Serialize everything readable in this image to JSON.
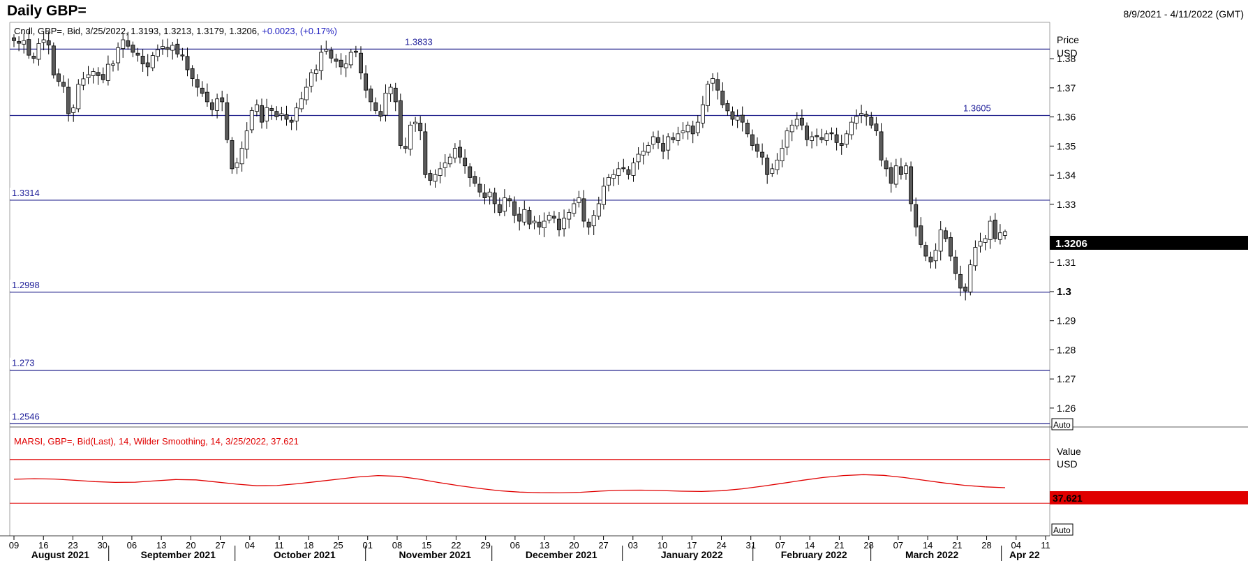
{
  "header": {
    "title": "Daily GBP=",
    "date_range": "8/9/2021 - 4/11/2022 (GMT)"
  },
  "price_panel": {
    "legend": "Cndl, GBP=, Bid, 3/25/2022, 1.3193, 1.3213, 1.3179, 1.3206,",
    "change": "+0.0023, (+0.17%)",
    "axis_title_1": "Price",
    "axis_title_2": "USD",
    "last_price": "1.3206",
    "auto_label": "Auto",
    "yticks": [
      {
        "v": 1.38,
        "label": "1.38"
      },
      {
        "v": 1.37,
        "label": "1.37"
      },
      {
        "v": 1.36,
        "label": "1.36"
      },
      {
        "v": 1.35,
        "label": "1.35"
      },
      {
        "v": 1.34,
        "label": "1.34"
      },
      {
        "v": 1.33,
        "label": "1.33"
      },
      {
        "v": 1.31,
        "label": "1.31"
      },
      {
        "v": 1.3,
        "label": "1.3",
        "bold": true
      },
      {
        "v": 1.29,
        "label": "1.29"
      },
      {
        "v": 1.28,
        "label": "1.28"
      },
      {
        "v": 1.27,
        "label": "1.27"
      },
      {
        "v": 1.26,
        "label": "1.26"
      }
    ]
  },
  "rsi_panel": {
    "legend": "MARSI, GBP=, Bid(Last),  14, Wilder Smoothing, 14, 3/25/2022, 37.621",
    "axis_title_1": "Value",
    "axis_title_2": "USD",
    "last_value": "37.621",
    "auto_label": "Auto"
  },
  "time_axis": {
    "day_ticks": [
      "09",
      "16",
      "23",
      "30",
      "06",
      "13",
      "20",
      "27",
      "04",
      "11",
      "18",
      "25",
      "01",
      "08",
      "15",
      "22",
      "29",
      "06",
      "13",
      "20",
      "27",
      "03",
      "10",
      "17",
      "24",
      "31",
      "07",
      "14",
      "21",
      "28",
      "07",
      "14",
      "21",
      "28",
      "04",
      "11"
    ],
    "months": [
      {
        "label": "August 2021",
        "day": 11
      },
      {
        "label": "September 2021",
        "day": 39
      },
      {
        "label": "October 2021",
        "day": 69
      },
      {
        "label": "November 2021",
        "day": 100
      },
      {
        "label": "December 2021",
        "day": 130
      },
      {
        "label": "January 2022",
        "day": 161
      },
      {
        "label": "February 2022",
        "day": 190
      },
      {
        "label": "March 2022",
        "day": 218
      },
      {
        "label": "Apr 22",
        "day": 240
      }
    ]
  },
  "colors": {
    "level_line": "#20208c",
    "level_text": "#20209a",
    "bear_candle": "#5a5a5a",
    "bull_candle": "#ffffff",
    "rsi_line": "#e00000",
    "rsi_badge": "#e00000",
    "price_badge": "#000000"
  },
  "chart_data": [
    {
      "type": "candlestick",
      "title": "Daily GBP=",
      "x_range": [
        "2021-08-09",
        "2022-04-11"
      ],
      "ylabel": "Price USD",
      "ylim": [
        1.2535,
        1.3925
      ],
      "horizontal_levels": [
        {
          "value": 1.3833,
          "label": "1.3833",
          "label_pos": "middle"
        },
        {
          "value": 1.3605,
          "label": "1.3605",
          "label_pos": "right"
        },
        {
          "value": 1.3314,
          "label": "1.3314",
          "label_pos": "left"
        },
        {
          "value": 1.2998,
          "label": "1.2998",
          "label_pos": "left"
        },
        {
          "value": 1.273,
          "label": "1.273",
          "label_pos": "left"
        },
        {
          "value": 1.2546,
          "label": "1.2546",
          "label_pos": "left"
        }
      ],
      "last": {
        "date": "2022-03-25",
        "open": 1.3193,
        "high": 1.3213,
        "low": 1.3179,
        "close": 1.3206
      },
      "closes": [
        1.3862,
        1.3853,
        1.3862,
        1.3812,
        1.3801,
        1.3852,
        1.3865,
        1.3847,
        1.3744,
        1.3722,
        1.3705,
        1.3611,
        1.3631,
        1.3712,
        1.3731,
        1.3745,
        1.3756,
        1.3742,
        1.3728,
        1.3781,
        1.3782,
        1.3838,
        1.3865,
        1.3843,
        1.3822,
        1.3812,
        1.3782,
        1.3772,
        1.3811,
        1.3831,
        1.3842,
        1.3832,
        1.3846,
        1.3816,
        1.3811,
        1.3762,
        1.3732,
        1.3702,
        1.3681,
        1.3652,
        1.3625,
        1.3662,
        1.3652,
        1.3522,
        1.3422,
        1.3442,
        1.3492,
        1.3552,
        1.3622,
        1.3642,
        1.3582,
        1.3632,
        1.3622,
        1.3601,
        1.3611,
        1.3592,
        1.3582,
        1.3631,
        1.3662,
        1.3702,
        1.3752,
        1.3762,
        1.3822,
        1.3832,
        1.3802,
        1.3791,
        1.3772,
        1.3782,
        1.3822,
        1.3822,
        1.3751,
        1.3692,
        1.3652,
        1.3622,
        1.3602,
        1.3682,
        1.3702,
        1.3652,
        1.3502,
        1.3492,
        1.3572,
        1.3582,
        1.3552,
        1.3402,
        1.3382,
        1.3402,
        1.3422,
        1.3442,
        1.3462,
        1.3492,
        1.3462,
        1.3432,
        1.3392,
        1.3372,
        1.3342,
        1.3322,
        1.3342,
        1.3302,
        1.3272,
        1.3322,
        1.3312,
        1.3262,
        1.3242,
        1.3282,
        1.3232,
        1.3242,
        1.3222,
        1.3242,
        1.3262,
        1.3252,
        1.3212,
        1.3252,
        1.3272,
        1.3302,
        1.3322,
        1.3242,
        1.3222,
        1.3262,
        1.3302,
        1.3362,
        1.3392,
        1.3402,
        1.3422,
        1.3422,
        1.3402,
        1.3442,
        1.3472,
        1.3482,
        1.3502,
        1.3532,
        1.3512,
        1.3482,
        1.3532,
        1.3522,
        1.3542,
        1.3552,
        1.3572,
        1.3542,
        1.3582,
        1.3642,
        1.3712,
        1.3732,
        1.3692,
        1.3642,
        1.3621,
        1.3592,
        1.3602,
        1.3582,
        1.3542,
        1.3502,
        1.3482,
        1.3462,
        1.3402,
        1.3422,
        1.3452,
        1.3492,
        1.3552,
        1.3572,
        1.3592,
        1.3572,
        1.3522,
        1.3532,
        1.3532,
        1.3522,
        1.3542,
        1.3542,
        1.3512,
        1.3502,
        1.3542,
        1.3582,
        1.3602,
        1.3612,
        1.3602,
        1.3572,
        1.3552,
        1.3452,
        1.3422,
        1.3372,
        1.3432,
        1.3402,
        1.3432,
        1.3302,
        1.3222,
        1.3162,
        1.3122,
        1.3102,
        1.3142,
        1.3212,
        1.3182,
        1.3122,
        1.3062,
        1.3012,
        1.3002,
        1.3092,
        1.3152,
        1.3172,
        1.3182,
        1.3242,
        1.3182,
        1.3202,
        1.3206
      ]
    },
    {
      "type": "line",
      "title": "MARSI, GBP=, Bid(Last), 14, Wilder Smoothing, 14",
      "ylabel": "Value USD",
      "last_value": 37.621,
      "upper_band": 70,
      "lower_band": 30,
      "ylim": [
        0,
        100
      ],
      "values": [
        52.0,
        52.5,
        52.2,
        51.0,
        49.8,
        49.1,
        49.3,
        50.6,
        51.7,
        51.4,
        49.5,
        47.5,
        46.0,
        46.2,
        47.8,
        49.9,
        52.0,
        54.1,
        55.4,
        54.7,
        52.2,
        49.0,
        46.1,
        43.6,
        41.4,
        40.2,
        39.6,
        39.5,
        40.0,
        41.1,
        41.9,
        42.0,
        41.6,
        41.0,
        40.8,
        41.5,
        43.2,
        45.6,
        48.3,
        51.1,
        53.6,
        55.4,
        56.2,
        55.6,
        53.6,
        51.0,
        48.5,
        46.4,
        45.0,
        44.2
      ]
    }
  ]
}
